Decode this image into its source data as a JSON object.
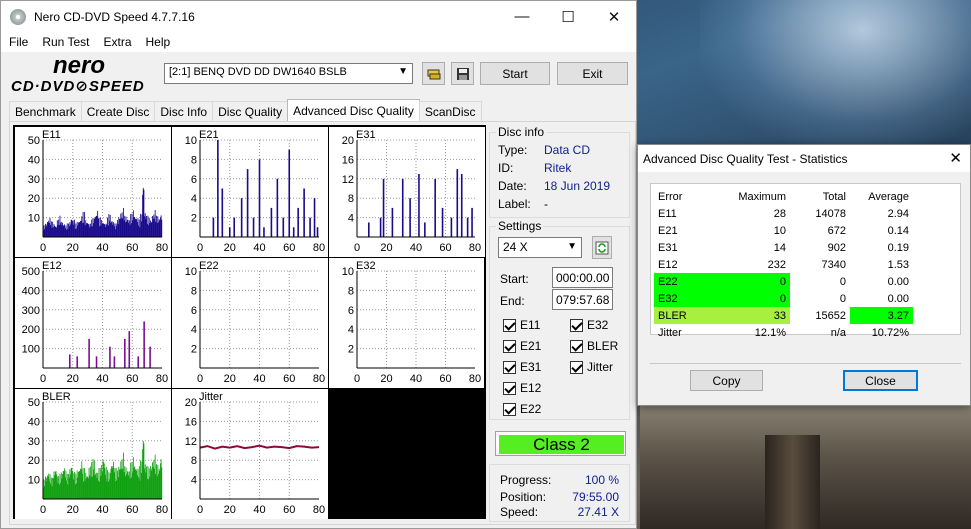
{
  "window": {
    "title": "Nero CD-DVD Speed 4.7.7.16",
    "minimize": "—",
    "maximize": "☐",
    "close": "✕"
  },
  "menu": [
    "File",
    "Run Test",
    "Extra",
    "Help"
  ],
  "logo": {
    "top": "nero",
    "bottom": "CD·DVD⊘SPEED"
  },
  "toolbar": {
    "drive": "[2:1]   BENQ DVD DD DW1640 BSLB",
    "start_label": "Start",
    "exit_label": "Exit",
    "drive_icon": "swap-drive-icon",
    "save_icon": "floppy-save-icon"
  },
  "tabs": [
    "Benchmark",
    "Create Disc",
    "Disc Info",
    "Disc Quality",
    "Advanced Disc Quality",
    "ScanDisc"
  ],
  "active_tab": 4,
  "disc_info": {
    "title": "Disc info",
    "type_label": "Type:",
    "type": "Data CD",
    "id_label": "ID:",
    "id": "Ritek",
    "date_label": "Date:",
    "date": "18 Jun 2019",
    "label_label": "Label:",
    "label": "-"
  },
  "settings": {
    "title": "Settings",
    "speed": "24 X",
    "start_label": "Start:",
    "start": "000:00.00",
    "end_label": "End:",
    "end": "079:57.68",
    "checks": [
      {
        "label": "E11",
        "checked": true
      },
      {
        "label": "E32",
        "checked": true
      },
      {
        "label": "E21",
        "checked": true
      },
      {
        "label": "BLER",
        "checked": true
      },
      {
        "label": "E31",
        "checked": true
      },
      {
        "label": "Jitter",
        "checked": true
      },
      {
        "label": "E12",
        "checked": true
      },
      {
        "label": "E22",
        "checked": true
      }
    ]
  },
  "class": "Class 2",
  "progress": {
    "progress_label": "Progress:",
    "progress": "100 %",
    "position_label": "Position:",
    "position": "79:55.00",
    "speed_label": "Speed:",
    "speed": "27.41 X"
  },
  "chart_data": [
    {
      "type": "bar",
      "name": "E11",
      "title": "E11",
      "ylim": [
        0,
        50
      ],
      "yticks": [
        10,
        20,
        30,
        40,
        50
      ],
      "xticks": [
        0,
        20,
        40,
        60,
        80
      ],
      "xlim": [
        0,
        80
      ],
      "color": "#1a0a8c",
      "profile": [
        6,
        7,
        9,
        10,
        8,
        7,
        6,
        9,
        11,
        8,
        7,
        6,
        7,
        8,
        10,
        9,
        7,
        8,
        9,
        11,
        13,
        9,
        8,
        7,
        9,
        10,
        12,
        14,
        10,
        9,
        8,
        7,
        10,
        12,
        9,
        8,
        7,
        9,
        11,
        13,
        15,
        11,
        10,
        9,
        12,
        14,
        11,
        10,
        9,
        12,
        28,
        13,
        11,
        10,
        9,
        12,
        14,
        11,
        10,
        12
      ]
    },
    {
      "type": "bar",
      "name": "E21",
      "title": "E21",
      "ylim": [
        0,
        10
      ],
      "yticks": [
        2,
        4,
        6,
        8,
        10
      ],
      "xticks": [
        0,
        20,
        40,
        60,
        80
      ],
      "xlim": [
        0,
        80
      ],
      "color": "#1a0a8c",
      "spikes": [
        [
          9,
          2
        ],
        [
          12,
          10
        ],
        [
          15,
          5
        ],
        [
          20,
          1
        ],
        [
          23,
          2
        ],
        [
          28,
          4
        ],
        [
          32,
          7
        ],
        [
          36,
          2
        ],
        [
          40,
          8
        ],
        [
          43,
          1
        ],
        [
          48,
          3
        ],
        [
          52,
          6
        ],
        [
          56,
          2
        ],
        [
          60,
          9
        ],
        [
          63,
          1
        ],
        [
          66,
          3
        ],
        [
          70,
          5
        ],
        [
          74,
          2
        ],
        [
          77,
          4
        ],
        [
          79,
          1
        ]
      ]
    },
    {
      "type": "bar",
      "name": "E31",
      "title": "E31",
      "ylim": [
        0,
        20
      ],
      "yticks": [
        4,
        8,
        12,
        16,
        20
      ],
      "xticks": [
        0,
        20,
        40,
        60,
        80
      ],
      "xlim": [
        0,
        80
      ],
      "color": "#1a0a8c",
      "spikes": [
        [
          8,
          3
        ],
        [
          16,
          4
        ],
        [
          18,
          12
        ],
        [
          24,
          6
        ],
        [
          31,
          12
        ],
        [
          36,
          8
        ],
        [
          42,
          13
        ],
        [
          46,
          3
        ],
        [
          53,
          12
        ],
        [
          58,
          6
        ],
        [
          64,
          4
        ],
        [
          68,
          14
        ],
        [
          71,
          13
        ],
        [
          75,
          4
        ],
        [
          78,
          6
        ]
      ]
    },
    {
      "type": "bar",
      "name": "E12",
      "title": "E12",
      "ylim": [
        0,
        500
      ],
      "yticks": [
        100,
        200,
        300,
        400,
        500
      ],
      "xticks": [
        0,
        20,
        40,
        60,
        80
      ],
      "xlim": [
        0,
        80
      ],
      "color": "#7a1090",
      "spikes": [
        [
          18,
          70
        ],
        [
          23,
          60
        ],
        [
          31,
          150
        ],
        [
          36,
          60
        ],
        [
          45,
          110
        ],
        [
          48,
          60
        ],
        [
          55,
          150
        ],
        [
          58,
          190
        ],
        [
          64,
          60
        ],
        [
          68,
          240
        ],
        [
          72,
          110
        ]
      ]
    },
    {
      "type": "bar",
      "name": "E22",
      "title": "E22",
      "ylim": [
        0,
        10
      ],
      "yticks": [
        2,
        4,
        6,
        8,
        10
      ],
      "xticks": [
        0,
        20,
        40,
        60,
        80
      ],
      "xlim": [
        0,
        80
      ],
      "color": "#1a0a8c",
      "spikes": []
    },
    {
      "type": "bar",
      "name": "E32",
      "title": "E32",
      "ylim": [
        0,
        10
      ],
      "yticks": [
        2,
        4,
        6,
        8,
        10
      ],
      "xticks": [
        0,
        20,
        40,
        60,
        80
      ],
      "xlim": [
        0,
        80
      ],
      "color": "#1a0a8c",
      "spikes": []
    },
    {
      "type": "bar",
      "name": "BLER",
      "title": "BLER",
      "ylim": [
        0,
        50
      ],
      "yticks": [
        10,
        20,
        30,
        40,
        50
      ],
      "xticks": [
        0,
        20,
        40,
        60,
        80
      ],
      "xlim": [
        0,
        80
      ],
      "color": "#10a010",
      "profile": [
        10,
        12,
        14,
        13,
        11,
        15,
        16,
        12,
        13,
        14,
        17,
        15,
        13,
        16,
        18,
        14,
        13,
        15,
        17,
        20,
        16,
        14,
        13,
        17,
        19,
        21,
        15,
        14,
        16,
        18,
        22,
        17,
        15,
        14,
        19,
        20,
        16,
        15,
        18,
        21,
        24,
        17,
        16,
        15,
        19,
        22,
        18,
        16,
        17,
        20,
        33,
        19,
        17,
        16,
        18,
        21,
        23,
        18,
        17,
        22
      ]
    },
    {
      "type": "line",
      "name": "Jitter",
      "title": "Jitter",
      "ylim": [
        0,
        20
      ],
      "yticks": [
        4,
        8,
        12,
        16,
        20
      ],
      "xticks": [
        0,
        20,
        40,
        60,
        80
      ],
      "xlim": [
        0,
        80
      ],
      "color": "#8c0a3a",
      "x": [
        0,
        5,
        10,
        15,
        20,
        25,
        30,
        35,
        40,
        45,
        50,
        55,
        60,
        65,
        70,
        75,
        80
      ],
      "y": [
        10.6,
        10.9,
        10.4,
        10.8,
        10.6,
        10.9,
        10.5,
        10.7,
        11.0,
        10.6,
        10.8,
        10.7,
        10.5,
        10.9,
        10.8,
        10.6,
        10.7
      ]
    }
  ],
  "stats": {
    "title": "Advanced Disc Quality Test - Statistics",
    "close_icon": "✕",
    "headers": [
      "Error",
      "Maximum",
      "Total",
      "Average"
    ],
    "rows": [
      [
        "E11",
        "28",
        "14078",
        "2.94"
      ],
      [
        "E21",
        "10",
        "672",
        "0.14"
      ],
      [
        "E31",
        "14",
        "902",
        "0.19"
      ],
      [
        "E12",
        "232",
        "7340",
        "1.53"
      ],
      [
        "E22",
        "0",
        "0",
        "0.00"
      ],
      [
        "E32",
        "0",
        "0",
        "0.00"
      ],
      [
        "BLER",
        "33",
        "15652",
        "3.27"
      ],
      [
        "Jitter",
        "12.1%",
        "n/a",
        "10.72%"
      ]
    ],
    "copy_label": "Copy",
    "close_label": "Close",
    "highlight_green": "#00ff00",
    "highlight_lime": "#a8f040"
  }
}
